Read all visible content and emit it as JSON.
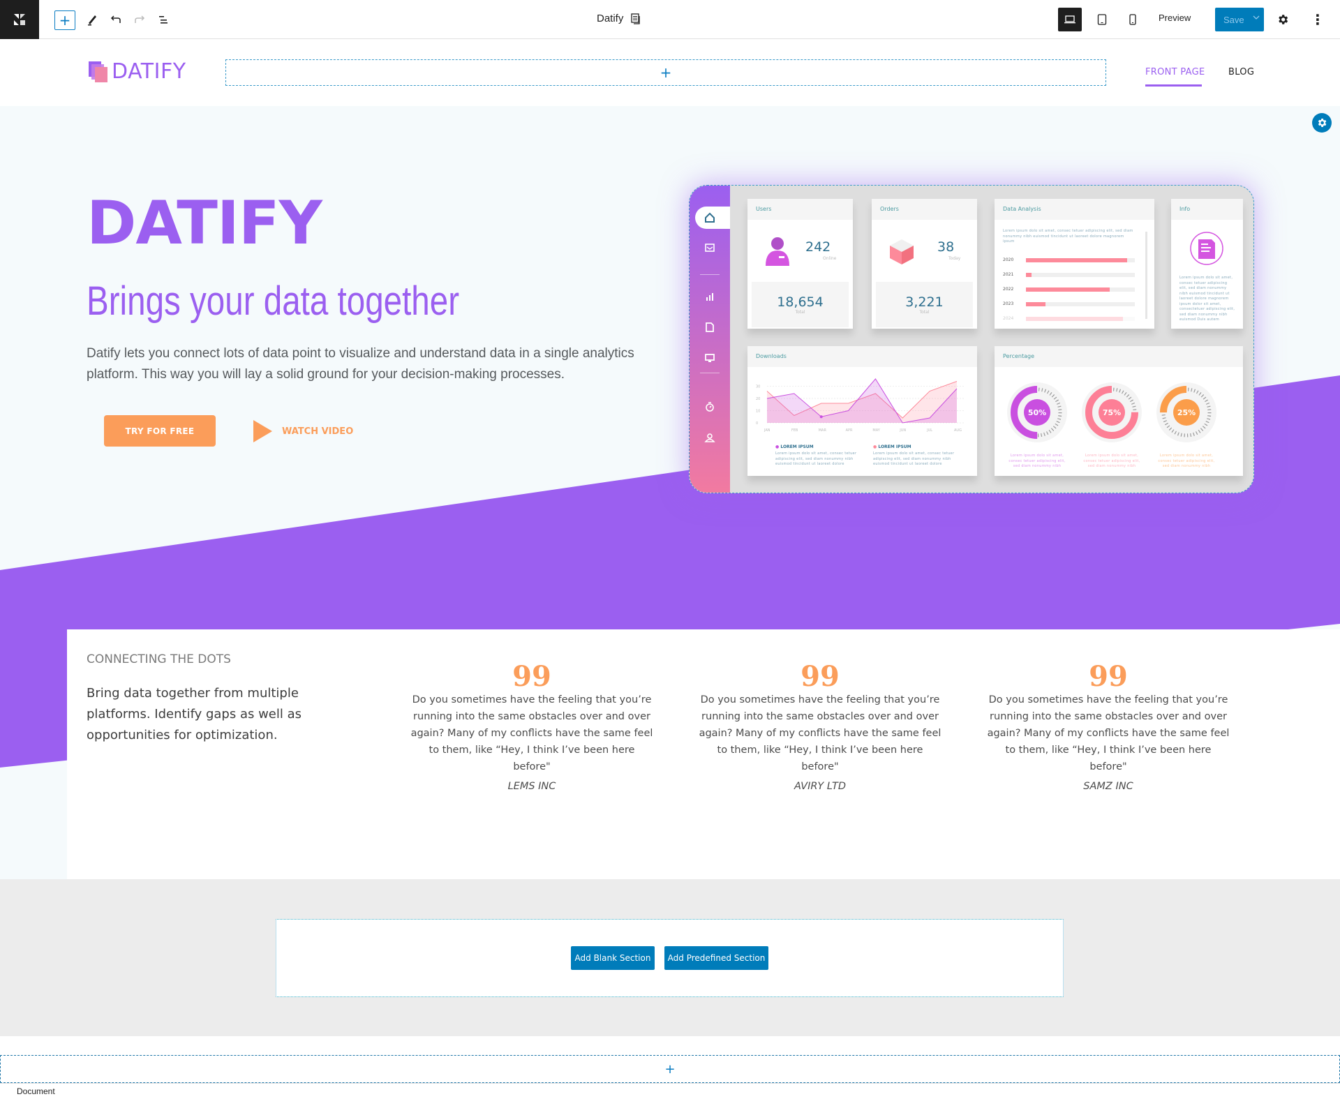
{
  "toolbar": {
    "logo_icon": "builder-logo-icon",
    "add_block_label": "+",
    "tools": [
      "add-block",
      "edit",
      "undo",
      "redo",
      "list-view"
    ],
    "document_title": "Datify",
    "document_icon": "document-icon",
    "devices": [
      "desktop",
      "tablet",
      "mobile"
    ],
    "active_device": "desktop",
    "preview_label": "Preview",
    "save_label": "Save",
    "save_caret": "⌄",
    "settings_icon": "gear-icon",
    "more_icon": "⋮"
  },
  "header": {
    "logo_text": "DATIFY",
    "add_placeholder": "+",
    "nav": [
      {
        "label": "FRONT PAGE",
        "active": true
      },
      {
        "label": "BLOG",
        "active": false
      }
    ]
  },
  "hero": {
    "title": "DATIFY",
    "subtitle": "Brings your data together",
    "description": "Datify lets you connect lots of data point to visualize and understand data in a single analytics platform. This way you will lay a solid ground for your decision-making processes.",
    "primary_cta": "TRY FOR FREE",
    "secondary_cta": "WATCH VIDEO",
    "accent_color": "#9b5ff0",
    "cta_color": "#fb9d5a"
  },
  "dashboard": {
    "users": {
      "title": "Users",
      "online": "242",
      "online_label": "Online",
      "total": "18,654",
      "total_label": "Total"
    },
    "orders": {
      "title": "Orders",
      "today": "38",
      "today_label": "Today",
      "total": "3,221",
      "total_label": "Total"
    },
    "data_analysis": {
      "title": "Data Analysis",
      "lorem": "Lorem ipsum dolo sit amet, consec tetuer adipiscing elit, sed diam nonummy nibh euismod tincidunt ut laoreet dolore magnorem ipsum",
      "bars": [
        {
          "year": "2020",
          "value": 0.93
        },
        {
          "year": "2021",
          "value": 0.05
        },
        {
          "year": "2022",
          "value": 0.77
        },
        {
          "year": "2023",
          "value": 0.18
        },
        {
          "year": "2024",
          "value": 0.89
        }
      ]
    },
    "info": {
      "title": "Info",
      "lorem": "Lorem ipsum dolo sit amet, consec tetuer adipiscing elit, sed diam nonummy nibh euismod tincidunt ut laoreet dolore magnorem ipsum dolor sit amet, consectetuer adipiscing elit, sed diam nonummy nibh euismod Duis autem"
    },
    "downloads": {
      "title": "Downloads",
      "months": [
        "JAN",
        "FEB",
        "MAR",
        "APR",
        "MAY",
        "JUN",
        "JUL",
        "AUG"
      ],
      "y_ticks": [
        "0",
        "10",
        "20",
        "30"
      ],
      "series": [
        {
          "name": "LOREM IPSUM",
          "color": "#c94fe0",
          "values": [
            20,
            24,
            5,
            10,
            36,
            0,
            4,
            28
          ]
        },
        {
          "name": "LOREM IPSUM",
          "color": "#fd8a9a",
          "values": [
            26,
            6,
            16,
            16,
            24,
            4,
            26,
            34
          ]
        }
      ],
      "legend_lorem": "Lorem ipsum dolo sit amet, consec tetuer adipiscing elit, sed diam nonummy nibh euismod tincidunt ut laoreet dolore"
    },
    "percentage": {
      "title": "Percentage",
      "items": [
        {
          "label": "50%",
          "value": 0.5,
          "color": "#c94fe0"
        },
        {
          "label": "75%",
          "value": 0.75,
          "color": "#fd7f96"
        },
        {
          "label": "25%",
          "value": 0.25,
          "color": "#fb9d4a"
        }
      ],
      "lorem": "Lorem ipsum dolo sit amet, consec tetuer adipiscing elit, sed diam nonummy nibh"
    }
  },
  "connect": {
    "kicker": "CONNECTING THE DOTS",
    "body": "Bring data together from multiple platforms. Identify gaps as well as opportunities for optimization.",
    "quote_mark": "99",
    "quotes": [
      {
        "text": "Do you sometimes have the feeling that you’re running into the same obstacles over and over again? Many of my conflicts have the same feel to them, like “Hey, I think I’ve been here before\"",
        "author": "LEMS INC"
      },
      {
        "text": "Do you sometimes have the feeling that you’re running into the same obstacles over and over again? Many of my conflicts have the same feel to them, like “Hey, I think I’ve been here before\"",
        "author": "AVIRY LTD"
      },
      {
        "text": "Do you sometimes have the feeling that you’re running into the same obstacles over and over again? Many of my conflicts have the same feel to them, like “Hey, I think I’ve been here before\"",
        "author": "SAMZ INC"
      }
    ]
  },
  "add_section": {
    "blank_label": "Add Blank Section",
    "predefined_label": "Add Predefined Section",
    "bottom_add": "+"
  },
  "status_bar": {
    "breadcrumb": "Document"
  }
}
